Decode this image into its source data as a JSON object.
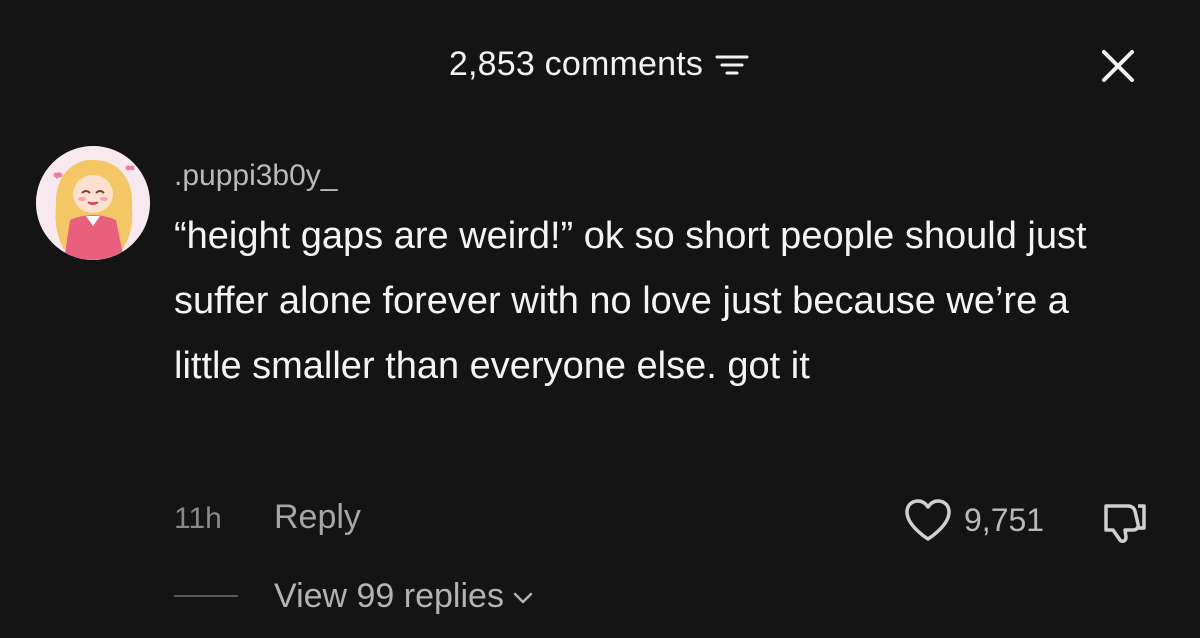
{
  "header": {
    "comment_count": "2,853 comments"
  },
  "comment": {
    "username": ".puppi3b0y_",
    "text": "“height gaps are weird!” ok so short people should just suffer alone forever with no love just because we’re a little smaller than everyone else. got it",
    "timestamp": "11h",
    "reply_label": "Reply",
    "like_count": "9,751"
  },
  "replies": {
    "label": "View 99 replies"
  },
  "icons": {
    "sort": "sort-icon",
    "close": "close-icon",
    "heart": "heart-icon",
    "dislike": "dislike-icon",
    "chevron": "chevron-down-icon"
  },
  "colors": {
    "background": "#141414",
    "text_primary": "#f4f4f4",
    "text_secondary": "#b9b9b9",
    "text_muted": "#8a8a8a"
  }
}
